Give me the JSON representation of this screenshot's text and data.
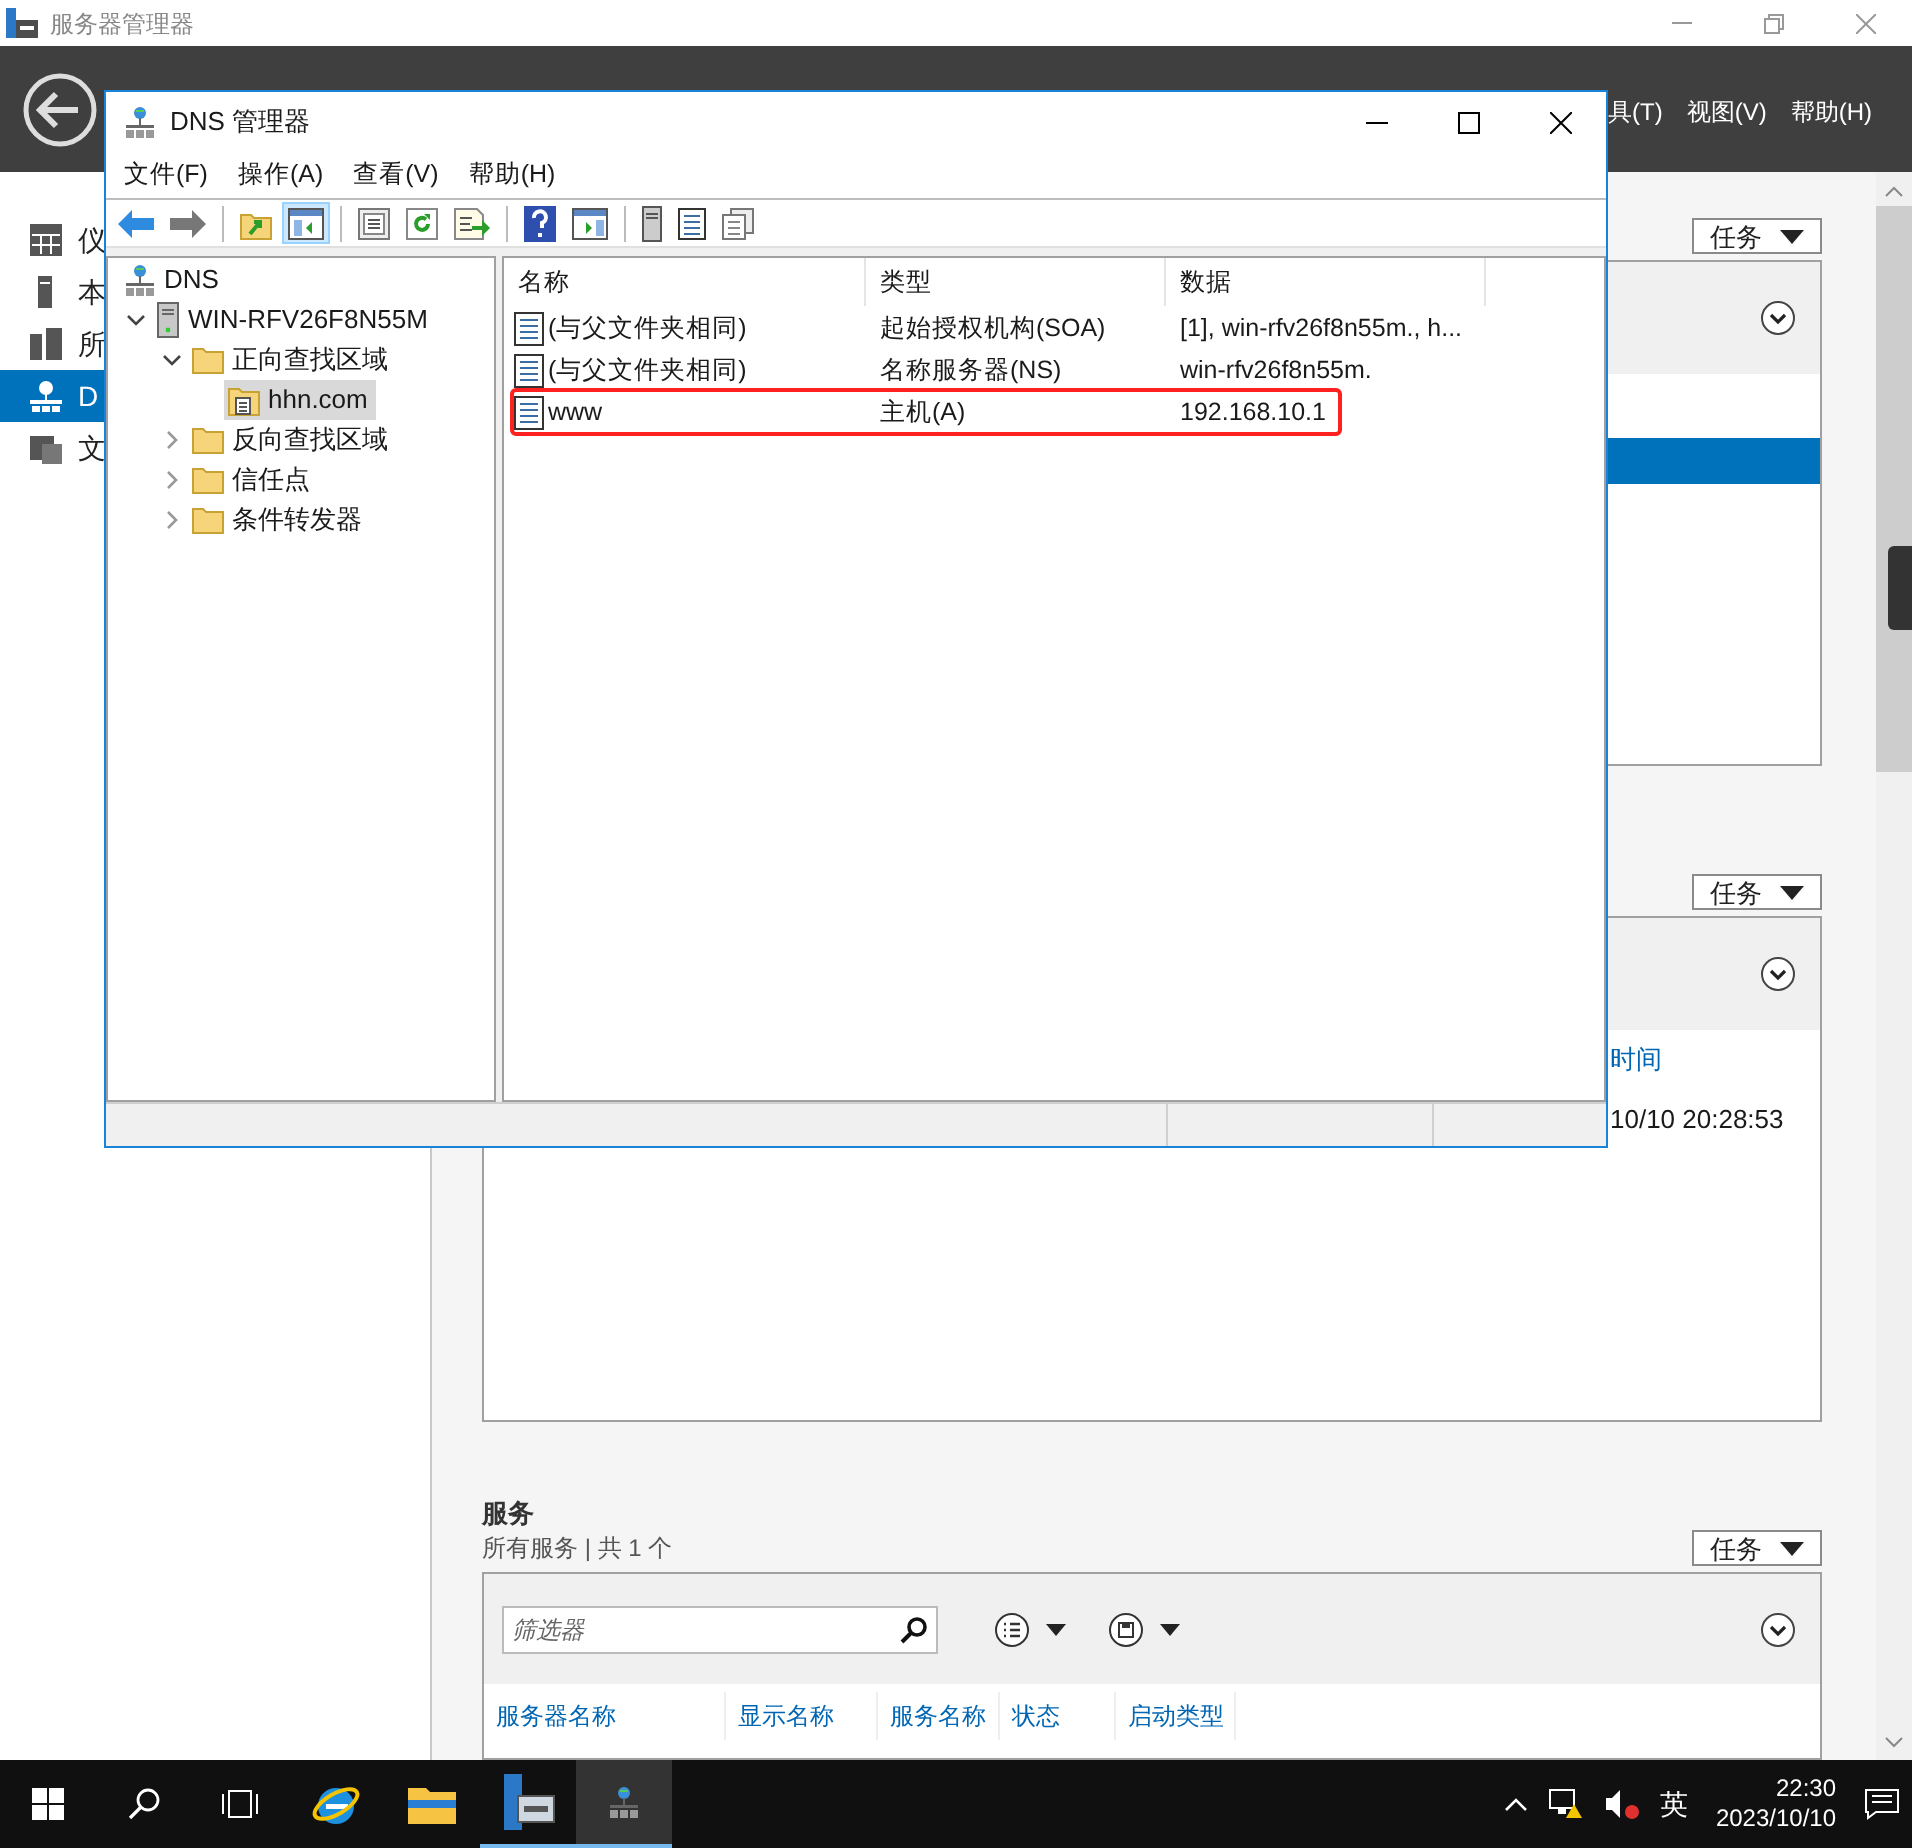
{
  "window": {
    "title": "服务器管理器"
  },
  "header": {
    "menu": [
      "具(T)",
      "视图(V)",
      "帮助(H)"
    ]
  },
  "nav": {
    "items": [
      {
        "label": "仪",
        "selected": false
      },
      {
        "label": "本",
        "selected": false
      },
      {
        "label": "所",
        "selected": false
      },
      {
        "label": "D",
        "selected": true
      },
      {
        "label": "文",
        "selected": false
      }
    ]
  },
  "panels": [
    {
      "tasks_button": "任务"
    },
    {
      "tasks_button": "任务",
      "column": "时间",
      "cell": "10/10 20:28:53"
    }
  ],
  "services": {
    "title": "服务",
    "subtitle": "所有服务 | 共 1 个",
    "tasks_button": "任务",
    "filter": {
      "placeholder": "筛选器"
    },
    "columns": [
      "服务器名称",
      "显示名称",
      "服务名称",
      "状态",
      "启动类型"
    ]
  },
  "dns_window": {
    "title": "DNS 管理器",
    "menu": [
      "文件(F)",
      "操作(A)",
      "查看(V)",
      "帮助(H)"
    ],
    "toolbar_buttons": [
      {
        "pressed": false
      },
      {
        "pressed": false
      },
      {
        "pressed": false
      },
      {
        "pressed": true
      },
      {
        "pressed": false
      },
      {
        "pressed": false
      },
      {
        "pressed": false
      },
      {
        "pressed": false
      },
      {
        "pressed": false
      },
      {
        "pressed": false
      },
      {
        "pressed": false
      },
      {
        "pressed": false
      }
    ],
    "tree": [
      {
        "label": "DNS",
        "selected": false,
        "children": [
          {
            "label": "WIN-RFV26F8N55M",
            "selected": false,
            "expanded": true,
            "children": [
              {
                "label": "正向查找区域",
                "selected": false,
                "expanded": true,
                "children": [
                  {
                    "label": "hhn.com",
                    "selected": true
                  }
                ]
              },
              {
                "label": "反向查找区域",
                "selected": false,
                "expanded": false
              },
              {
                "label": "信任点",
                "selected": false,
                "expanded": false
              },
              {
                "label": "条件转发器",
                "selected": false,
                "expanded": false
              }
            ]
          }
        ]
      }
    ],
    "list": {
      "columns": [
        "名称",
        "类型",
        "数据"
      ],
      "rows": [
        {
          "name": "(与父文件夹相同)",
          "type": "起始授权机构(SOA)",
          "data": "[1], win-rfv26f8n55m., h...",
          "highlighted": false
        },
        {
          "name": "(与父文件夹相同)",
          "type": "名称服务器(NS)",
          "data": "win-rfv26f8n55m.",
          "highlighted": false
        },
        {
          "name": "www",
          "type": "主机(A)",
          "data": "192.168.10.1",
          "highlighted": true
        }
      ]
    }
  },
  "taskbar": {
    "input_indicator": "英",
    "time": "22:30",
    "date": "2023/10/10"
  }
}
